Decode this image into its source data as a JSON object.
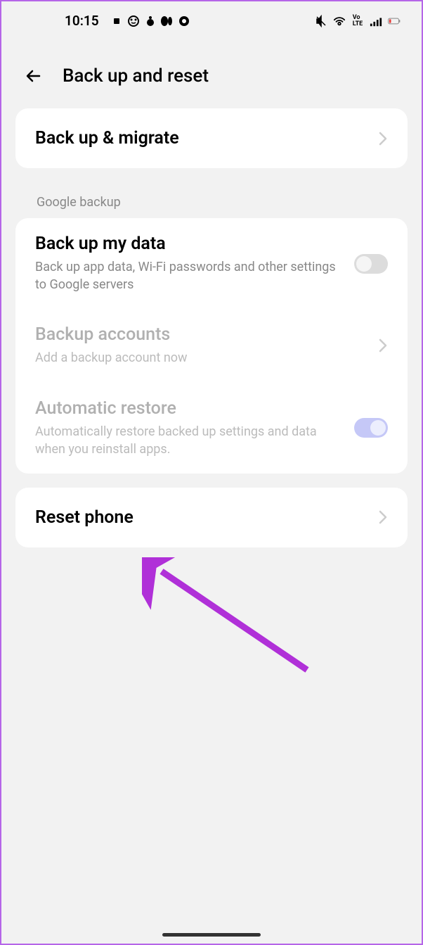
{
  "status_bar": {
    "time": "10:15"
  },
  "header": {
    "title": "Back up and reset"
  },
  "backup_migrate": {
    "title": "Back up & migrate"
  },
  "section_label": "Google backup",
  "backup_my_data": {
    "title": "Back up my data",
    "subtitle": "Back up app data, Wi-Fi passwords and other settings to Google servers"
  },
  "backup_accounts": {
    "title": "Backup accounts",
    "subtitle": "Add a backup account now"
  },
  "automatic_restore": {
    "title": "Automatic restore",
    "subtitle": "Automatically restore backed up settings and data when you reinstall apps."
  },
  "reset_phone": {
    "title": "Reset phone"
  }
}
